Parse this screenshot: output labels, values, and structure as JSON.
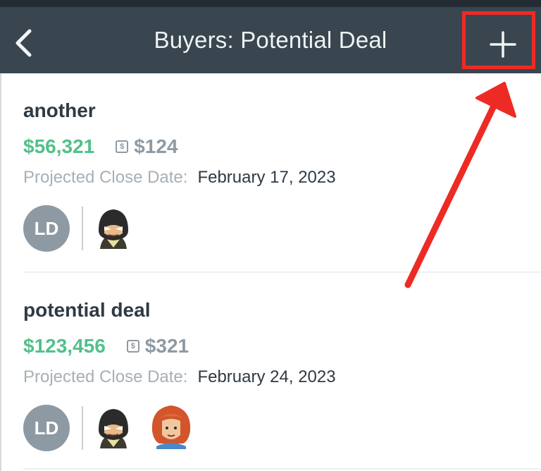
{
  "navbar": {
    "title": "Buyers: Potential Deal",
    "back_icon": "chevron-left-icon",
    "add_icon": "plus-icon"
  },
  "deals": [
    {
      "name": "another",
      "amount": "$56,321",
      "fee_icon": "dollar-badge-icon",
      "fee": "$124",
      "close_label": "Projected Close Date:",
      "close_date": "February 17, 2023",
      "owner_initials": "LD",
      "avatars": [
        "helmeted-character-avatar"
      ]
    },
    {
      "name": "potential deal",
      "amount": "$123,456",
      "fee_icon": "dollar-badge-icon",
      "fee": "$321",
      "close_label": "Projected Close Date:",
      "close_date": "February 24, 2023",
      "owner_initials": "LD",
      "avatars": [
        "helmeted-character-avatar",
        "red-haired-character-avatar"
      ]
    }
  ],
  "colors": {
    "navbar": "#39464f",
    "amount": "#52c08b",
    "annotation": "#ee2a24"
  }
}
